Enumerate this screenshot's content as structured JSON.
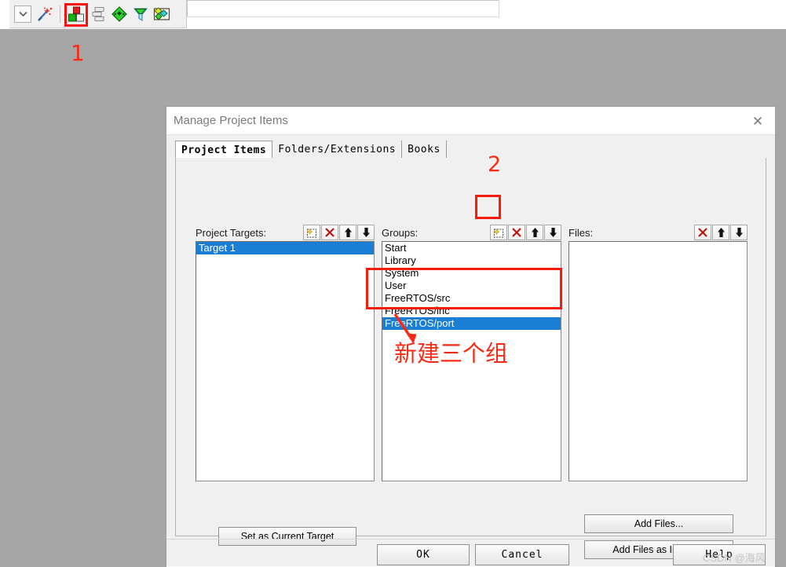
{
  "toolbar": {
    "items": [
      {
        "name": "dropdown-toggle",
        "icon": "chevron-down-icon"
      },
      {
        "name": "build-wizard",
        "icon": "magic-wand-icon"
      },
      {
        "name": "manage-project-items",
        "icon": "project-blocks-icon"
      },
      {
        "name": "manage-components",
        "icon": "stacked-layers-icon"
      },
      {
        "name": "configuration-wizard",
        "icon": "green-diamond-icon"
      },
      {
        "name": "filter-items",
        "icon": "funnel-icon"
      },
      {
        "name": "pack-installer",
        "icon": "multi-diamond-icon"
      }
    ],
    "annotation_1": "1"
  },
  "dialog": {
    "title": "Manage Project Items",
    "close_label": "✕",
    "tabs": [
      {
        "label": "Project Items",
        "active": true
      },
      {
        "label": "Folders/Extensions",
        "active": false
      },
      {
        "label": "Books",
        "active": false
      }
    ],
    "annotation_2": "2",
    "annotation_cn": "新建三个组",
    "panels": {
      "targets": {
        "label": "Project Targets:",
        "buttons": [
          "new-item-icon",
          "delete-icon",
          "move-up-icon",
          "move-down-icon"
        ],
        "items": [
          {
            "label": "Target 1",
            "selected": true
          }
        ]
      },
      "groups": {
        "label": "Groups:",
        "buttons": [
          "new-item-icon",
          "delete-icon",
          "move-up-icon",
          "move-down-icon"
        ],
        "items": [
          {
            "label": "Start",
            "selected": false
          },
          {
            "label": "Library",
            "selected": false
          },
          {
            "label": "System",
            "selected": false
          },
          {
            "label": "User",
            "selected": false
          },
          {
            "label": "FreeRTOS/src",
            "selected": false
          },
          {
            "label": "FreeRTOS/inc",
            "selected": false
          },
          {
            "label": "FreeRTOS/port",
            "selected": true
          }
        ]
      },
      "files": {
        "label": "Files:",
        "buttons": [
          "delete-icon",
          "move-up-icon",
          "move-down-icon"
        ],
        "items": []
      }
    },
    "buttons": {
      "set_as_current_target": "Set as Current Target",
      "add_files": "Add Files...",
      "add_files_as_image": "Add Files as Image...",
      "ok": "OK",
      "cancel": "Cancel",
      "help": "Help"
    }
  },
  "watermark": "CSDN @海风",
  "colors": {
    "annotation_red": "#fb2a16",
    "selection_blue": "#1a7fd4",
    "dialog_bg": "#f0f0f0",
    "desktop_bg": "#a6a6a6"
  }
}
